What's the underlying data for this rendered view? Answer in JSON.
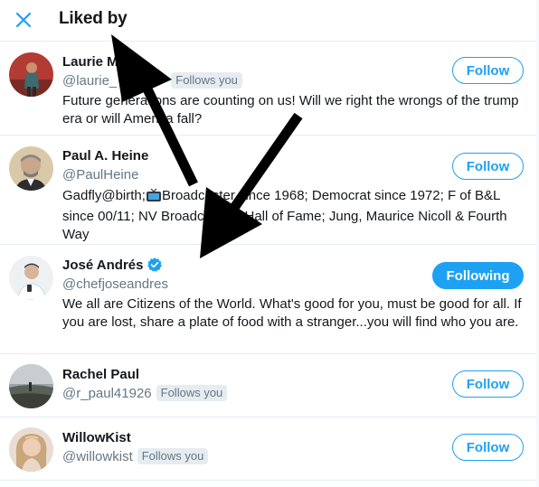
{
  "header": {
    "title": "Liked by",
    "close_icon": "close-icon"
  },
  "colors": {
    "accent": "#1da1f2",
    "text": "#14171a",
    "secondary": "#657786",
    "divider": "#e6ecf0"
  },
  "users": [
    {
      "name": "Laurie M",
      "handle": "@laurie_",
      "follows_you": "Follows you",
      "bio": "Future generations are counting on us! Will we right the wrongs of the trump era or will America fall?",
      "button": "Follow",
      "verified": false
    },
    {
      "name": "Paul A. Heine",
      "handle": "@PaulHeine",
      "follows_you": "",
      "bio_part1": "Gadfly@birth;",
      "bio_part2": "Broadcaster since 1968; Democrat since 1972; F of B&L since 00/11; NV Broadcasters Hall of Fame; Jung, Maurice Nicoll & Fourth Way",
      "button": "Follow",
      "verified": false
    },
    {
      "name": "José Andrés",
      "handle": "@chefjoseandres",
      "follows_you": "",
      "bio": "We all are Citizens of the World. What's good for you, must be good for all. If you are lost, share a plate of food with a stranger...you will find who you are.",
      "button": "Following",
      "verified": true
    },
    {
      "name": "Rachel Paul",
      "handle": "@r_paul41926",
      "follows_you": "Follows you",
      "bio": "",
      "button": "Follow",
      "verified": false
    },
    {
      "name": "WillowKist",
      "handle": "@willowkist",
      "follows_you": "Follows you",
      "bio": "",
      "button": "Follow",
      "verified": false
    }
  ]
}
